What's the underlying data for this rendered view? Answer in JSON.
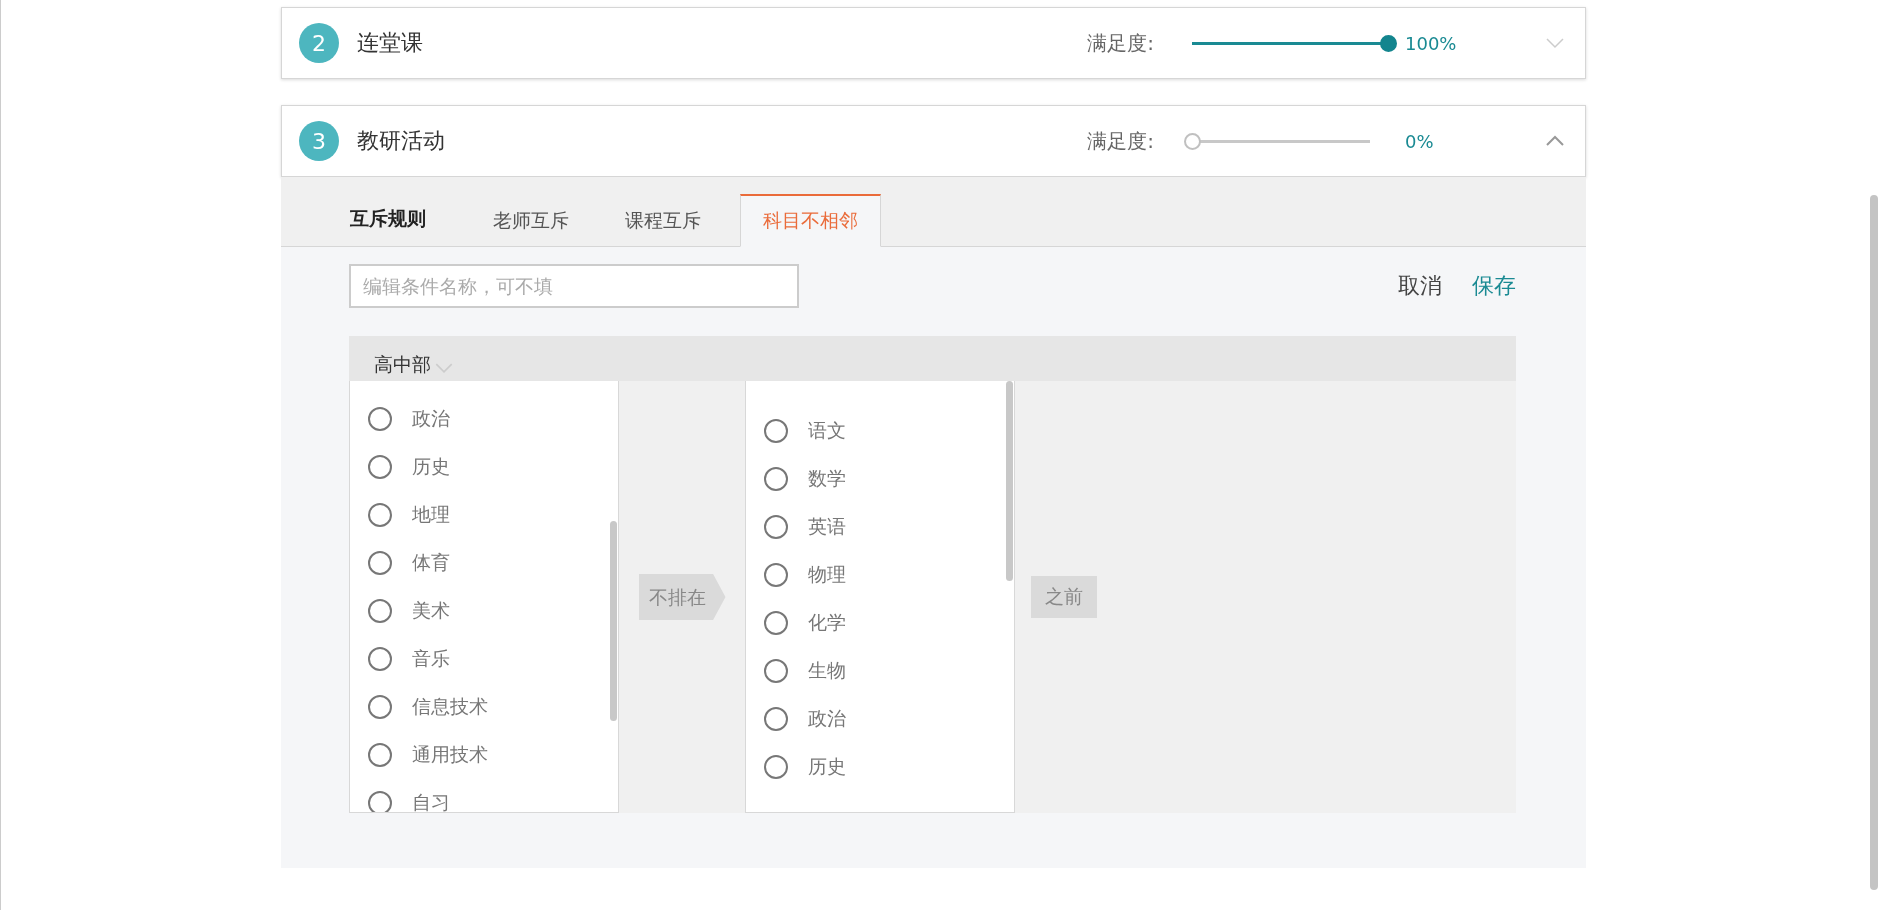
{
  "sections": [
    {
      "number": "2",
      "title": "连堂课",
      "satisfaction_label": "满足度:",
      "level": 1,
      "reading": "100%",
      "expanded": false
    },
    {
      "number": "3",
      "title": "教研活动",
      "satisfaction_label": "满足度:",
      "level": 0,
      "reading": "0%",
      "expanded": true
    }
  ],
  "rules_heading": "互斥规则",
  "tabs": [
    {
      "label": "老师互斥",
      "selected": false
    },
    {
      "label": "课程互斥",
      "selected": false
    },
    {
      "label": "科目不相邻",
      "selected": true
    }
  ],
  "name_field": {
    "placeholder": "编辑条件名称，可不填"
  },
  "actions": [
    {
      "label": "取消",
      "kind": "cancel"
    },
    {
      "label": "保存",
      "kind": "save"
    }
  ],
  "group": {
    "label": "高中部"
  },
  "left_list": [
    {
      "label": "政治",
      "checked": false
    },
    {
      "label": "历史",
      "checked": false
    },
    {
      "label": "地理",
      "checked": false
    },
    {
      "label": "体育",
      "checked": false
    },
    {
      "label": "美术",
      "checked": false
    },
    {
      "label": "音乐",
      "checked": false
    },
    {
      "label": "信息技术",
      "checked": false
    },
    {
      "label": "通用技术",
      "checked": false
    },
    {
      "label": "自习",
      "checked": false
    }
  ],
  "connector": "不排在",
  "right_list": [
    {
      "label": "语文",
      "checked": false
    },
    {
      "label": "数学",
      "checked": false
    },
    {
      "label": "英语",
      "checked": false
    },
    {
      "label": "物理",
      "checked": false
    },
    {
      "label": "化学",
      "checked": false
    },
    {
      "label": "生物",
      "checked": false
    },
    {
      "label": "政治",
      "checked": false
    },
    {
      "label": "历史",
      "checked": false
    }
  ],
  "suffix": "之前"
}
